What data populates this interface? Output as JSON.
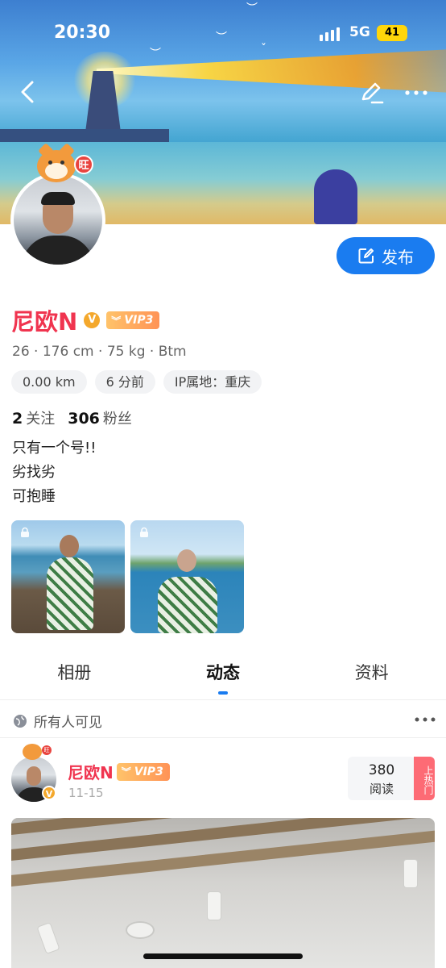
{
  "status_bar": {
    "time": "20:30",
    "network": "5G",
    "battery": "41"
  },
  "nav": {
    "back_icon": "chevron-left-icon",
    "edit_icon": "pencil-icon",
    "more_icon": "more-icon"
  },
  "profile": {
    "badge_text": "旺",
    "name": "尼欧N",
    "verified_text": "V",
    "vip_label": "VIP3",
    "stats": "26 · 176 cm · 75 kg · Btm",
    "chips": [
      "0.00 km",
      "6 分前",
      "IP属地：重庆"
    ],
    "following_count": "2",
    "following_label": "关注",
    "followers_count": "306",
    "followers_label": "粉丝",
    "bio": [
      "只有一个号!!",
      "劣找劣",
      "可抱睡"
    ]
  },
  "publish_button": {
    "label": "发布"
  },
  "tabs": [
    {
      "label": "相册",
      "active": false
    },
    {
      "label": "动态",
      "active": true
    },
    {
      "label": "资料",
      "active": false
    }
  ],
  "visibility": {
    "label": "所有人可见"
  },
  "post": {
    "author": "尼欧N",
    "vip_label": "VIP3",
    "date": "11-15",
    "reads_count": "380",
    "reads_label": "阅读",
    "hot_label": "上热门"
  },
  "colors": {
    "accent": "#1a7cf0",
    "name": "#f0344f",
    "vip": "#ff9356",
    "hot": "#fd6b75"
  }
}
